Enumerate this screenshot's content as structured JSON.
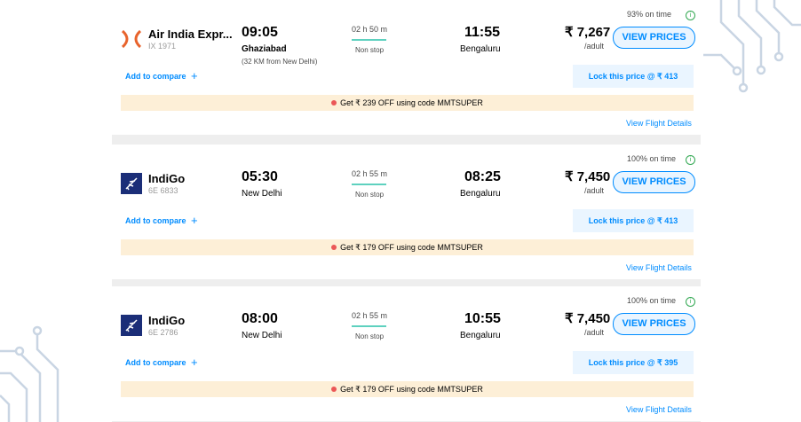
{
  "flights": [
    {
      "airline": "Air India Expr...",
      "logo_icon": "air-india-express-logo",
      "flight_no": "IX 1971",
      "dep_time": "09:05",
      "dep_city": "Ghaziabad",
      "dep_sub": "(32 KM from New Delhi)",
      "duration": "02 h 50 m",
      "stops": "Non stop",
      "arr_time": "11:55",
      "arr_city": "Bengaluru",
      "on_time": "93% on time",
      "price": "₹ 7,267",
      "per": "/adult",
      "view_prices": "VIEW PRICES",
      "compare": "Add to compare",
      "lock": "Lock this price @ ₹ 413",
      "offer": "Get ₹ 239 OFF using code MMTSUPER",
      "details": "View Flight Details"
    },
    {
      "airline": "IndiGo",
      "logo_icon": "indigo-logo",
      "flight_no": "6E 6833",
      "dep_time": "05:30",
      "dep_city": "New Delhi",
      "duration": "02 h 55 m",
      "stops": "Non stop",
      "arr_time": "08:25",
      "arr_city": "Bengaluru",
      "on_time": "100% on time",
      "price": "₹ 7,450",
      "per": "/adult",
      "view_prices": "VIEW PRICES",
      "compare": "Add to compare",
      "lock": "Lock this price @ ₹ 413",
      "offer": "Get ₹ 179 OFF using code MMTSUPER",
      "details": "View Flight Details"
    },
    {
      "airline": "IndiGo",
      "logo_icon": "indigo-logo",
      "flight_no": "6E 2786",
      "dep_time": "08:00",
      "dep_city": "New Delhi",
      "duration": "02 h 55 m",
      "stops": "Non stop",
      "arr_time": "10:55",
      "arr_city": "Bengaluru",
      "on_time": "100% on time",
      "price": "₹ 7,450",
      "per": "/adult",
      "view_prices": "VIEW PRICES",
      "compare": "Add to compare",
      "lock": "Lock this price @ ₹ 395",
      "offer": "Get ₹ 179 OFF using code MMTSUPER",
      "details": "View Flight Details"
    }
  ],
  "colors": {
    "accent": "#008cff",
    "lock_bg": "#eaf5ff",
    "offer_bg": "#fdefd7",
    "duration_line": "#5ed1bf",
    "on_time_icon": "#32a852",
    "offer_dot": "#eb5757",
    "air_india_logo": "#e8632c",
    "indigo_logo": "#1b2e78"
  }
}
